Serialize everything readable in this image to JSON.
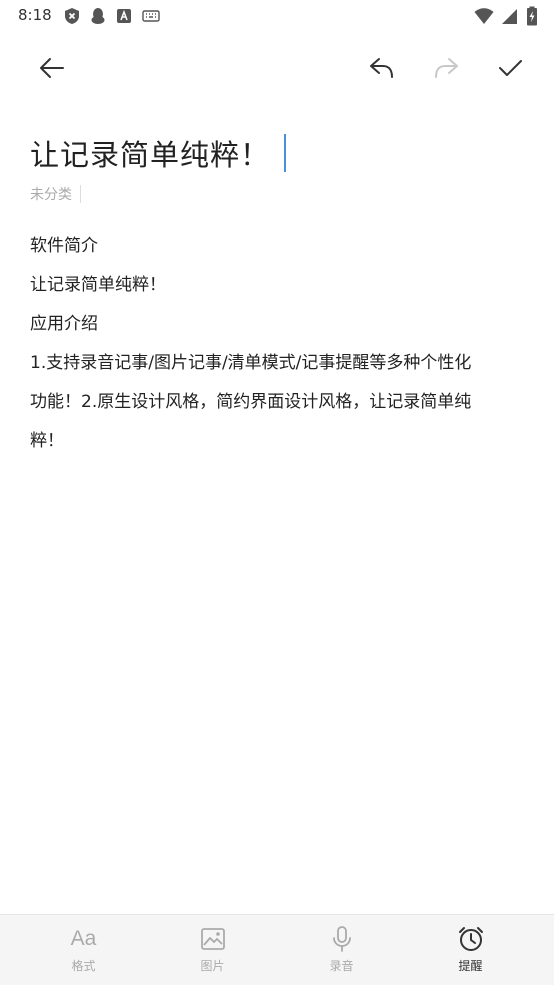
{
  "status_bar": {
    "time": "8:18",
    "left_icons": [
      "shield-x-icon",
      "qq-penguin-icon",
      "font-a-icon",
      "keyboard-icon"
    ],
    "right_icons": [
      "wifi-icon",
      "signal-icon",
      "battery-charging-icon"
    ]
  },
  "toolbar": {
    "icons": [
      "back-arrow-icon",
      "undo-icon",
      "redo-icon",
      "check-icon"
    ]
  },
  "note": {
    "title": "让记录简单纯粹！",
    "category": "未分类",
    "body": [
      "软件简介",
      "让记录简单纯粹！",
      "应用介绍",
      "1.支持录音记事/图片记事/清单模式/记事提醒等多种个性化",
      "功能！2.原生设计风格，简约界面设计风格，让记录简单纯",
      "粹！"
    ]
  },
  "bottom_bar": {
    "items": [
      {
        "label": "格式",
        "icon_text": "Aa"
      },
      {
        "label": "图片"
      },
      {
        "label": "录音"
      },
      {
        "label": "提醒"
      }
    ]
  },
  "colors": {
    "caret": "#4a90d9",
    "bottom_bar_bg": "#f5f5f5",
    "inactive_icon": "#aaaaaa",
    "active_icon": "#333333"
  }
}
